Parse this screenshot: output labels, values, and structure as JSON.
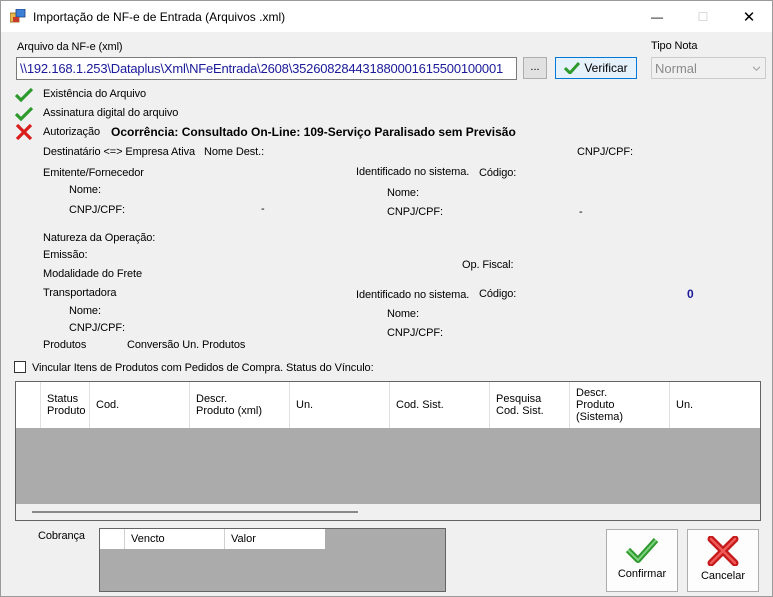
{
  "window": {
    "title": "Importação de NF-e de Entrada (Arquivos .xml)",
    "minimize": "—",
    "maximize": "☐",
    "close": "✕"
  },
  "file": {
    "label": "Arquivo da NF-e (xml)",
    "path": "\\\\192.168.1.253\\Dataplus\\Xml\\NFeEntrada\\2608\\352608284431880001615500100001",
    "browse_label": "...",
    "verify_label": "Verificar"
  },
  "tipo_nota": {
    "label": "Tipo Nota",
    "value": "Normal"
  },
  "checks": {
    "existencia": "Existência do Arquivo",
    "assinatura": "Assinatura digital do arquivo",
    "autorizacao": "Autorização",
    "ocorrencia": "Ocorrência: Consultado On-Line: 109-Serviço Paralisado sem Previsão"
  },
  "destinatario": {
    "label": "Destinatário <=> Empresa Ativa",
    "nome_dest": "Nome Dest.:",
    "cnpj": "CNPJ/CPF:"
  },
  "emitente": {
    "label": "Emitente/Fornecedor",
    "nome": "Nome:",
    "cnpj": "CNPJ/CPF:",
    "cnpj_value": "-",
    "identificado": "Identificado no sistema.",
    "codigo": "Código:",
    "sis_nome": "Nome:",
    "sis_cnpj": "CNPJ/CPF:",
    "sis_cnpj_value": "-"
  },
  "operacao": {
    "natureza": "Natureza da Operação:",
    "emissao": "Emissão:",
    "op_fiscal": "Op. Fiscal:",
    "modalidade": "Modalidade do Frete"
  },
  "transportadora": {
    "label": "Transportadora",
    "nome": "Nome:",
    "cnpj": "CNPJ/CPF:",
    "identificado": "Identificado no sistema.",
    "codigo": "Código:",
    "codigo_value": "0",
    "sis_nome": "Nome:",
    "sis_cnpj": "CNPJ/CPF:"
  },
  "produtos": {
    "label": "Produtos",
    "conversao": "Conversão Un. Produtos",
    "vincular": "Vincular Itens de Produtos com Pedidos de Compra. Status do Vínculo:"
  },
  "grid": {
    "columns": [
      {
        "label": "Status\nProduto"
      },
      {
        "label": "Cod."
      },
      {
        "label": "Descr.\nProduto (xml)"
      },
      {
        "label": "Un."
      },
      {
        "label": "Cod. Sist."
      },
      {
        "label": "Pesquisa\nCod. Sist."
      },
      {
        "label": "Descr.\nProduto\n(Sistema)"
      },
      {
        "label": "Un."
      }
    ]
  },
  "cobranca": {
    "label": "Cobrança",
    "columns": [
      {
        "label": "Vencto"
      },
      {
        "label": "Valor"
      }
    ]
  },
  "actions": {
    "confirmar": "Confirmar",
    "cancelar": "Cancelar"
  },
  "colors": {
    "link_blue": "#1a1a9a",
    "check_green": "#2e9a2e",
    "error_red": "#d91c1c",
    "grid_gray": "#ababab"
  }
}
